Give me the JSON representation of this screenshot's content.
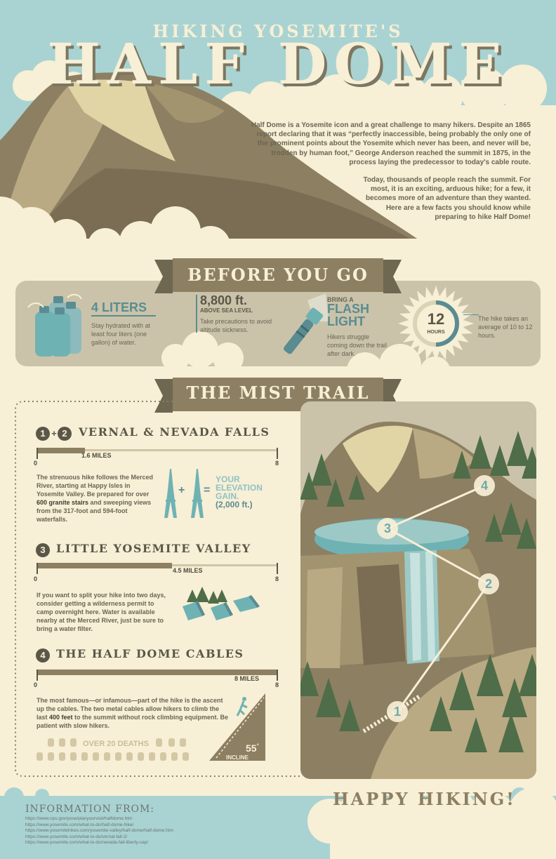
{
  "header": {
    "subtitle": "HIKING YOSEMITE'S",
    "title": "HALF DOME"
  },
  "intro": {
    "para1": "Half Dome is a Yosemite icon and a great challenge to many hikers. Despite an 1865 report declaring that it was “perfectly inaccessible, being probably the only one of the prominent points about the Yosemite which never has been, and never will be, trodden by human foot,” George Anderson reached the summit in 1875, in the process laying the predecessor to today's cable route.",
    "para2": "Today, thousands of people reach the summit. For most, it is an exciting, arduous hike; for a few, it becomes more of an adventure than they wanted. Here are a few facts you should know while preparing to hike Half Dome!"
  },
  "before": {
    "banner": "BEFORE YOU GO",
    "water_title": "4 LITERS",
    "water_text": "Stay hydrated with at least four liters (one gallon) of water.",
    "altitude_value": "8,800 ft.",
    "altitude_sub": "ABOVE SEA LEVEL",
    "altitude_text": "Take precautions to avoid altitude sickness.",
    "bring": "BRING A",
    "flash1": "FLASH",
    "flash2": "LIGHT",
    "flash_text": "Hikers struggle coming down the trail after dark.",
    "hours_value": "12",
    "hours_unit": "HOURS",
    "hours_text": "The hike takes an average of 10 to 12 hours.",
    "hours_fraction": 0.5
  },
  "mist": {
    "banner": "THE MIST TRAIL",
    "s1_n1": "1",
    "s1_plus": "+",
    "s1_n2": "2",
    "s1_title": "VERNAL & NEVADA FALLS",
    "s1_miles": "1.6 MILES",
    "s1_fraction": 0.2,
    "s1_text_a": "The strenuous hike follows the Merced River, starting at Happy Isles in Yosemite Valley. Be prepared for over ",
    "s1_text_b": "600 granite stairs",
    "s1_text_c": " and sweeping views from the 317-foot and 594-foot waterfalls.",
    "elev_plus": "+",
    "elev_eq": "=",
    "elev1": "YOUR",
    "elev2": "ELEVATION",
    "elev3": "GAIN.",
    "elev4": "(2,000 ft.)",
    "s2_n": "3",
    "s2_title": "LITTLE YOSEMITE VALLEY",
    "s2_miles": "4.5 MILES",
    "s2_fraction": 0.56,
    "s2_text": "If you want to split your hike into two days, consider getting a wilderness permit to camp overnight here. Water is available nearby at the Merced River, just be sure to bring a water filter.",
    "s3_n": "4",
    "s3_title": "THE HALF DOME CABLES",
    "s3_miles": "8 MILES",
    "s3_fraction": 1.0,
    "s3_text_a": "The most famous—or infamous—part of the hike is the ascent up the cables. The two metal cables allow hikers to climb the last ",
    "s3_text_b": "400 feet",
    "s3_text_c": " to the summit without rock climbing equipment. Be patient with slow hikers.",
    "deaths": "OVER 20 DEATHS",
    "incline_value": "55",
    "incline_deg": "°",
    "incline_label": "INCLINE",
    "scale_min": "0",
    "scale_max": "8",
    "map_markers": [
      "1",
      "2",
      "3",
      "4"
    ]
  },
  "footer": {
    "info_title": "INFORMATION FROM:",
    "sources": [
      "https://www.nps.gov/yose/planyourvisit/halfdome.htm",
      "https://www.yosemite.com/what-to-do/half-dome-hike/",
      "https://www.yosemitehikes.com/yosemite-valley/half-dome/half-dome.htm",
      "https://www.yosemite.com/what-to-do/vernal-fall-2/",
      "https://www.yosemite.com/what-to-do/nevada-fall-liberty-cap/"
    ],
    "happy": "HAPPY HIKING!"
  },
  "colors": {
    "sky": "#a9d3d2",
    "cream": "#f7efd6",
    "olive": "#8d7f62",
    "dark": "#5a5748",
    "teal": "#6fb2b3",
    "tealdark": "#5a8c91",
    "panel": "#cac3aa",
    "forest": "#4f6d48"
  }
}
